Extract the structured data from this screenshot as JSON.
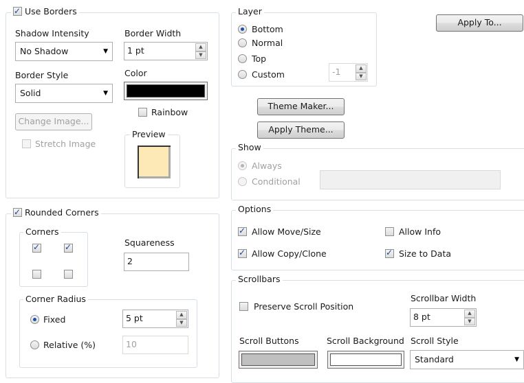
{
  "borders": {
    "use_borders_label": "Use Borders",
    "use_borders_checked": true,
    "shadow_intensity_label": "Shadow Intensity",
    "shadow_intensity_value": "No Shadow",
    "border_width_label": "Border Width",
    "border_width_value": "1 pt",
    "border_style_label": "Border Style",
    "border_style_value": "Solid",
    "color_label": "Color",
    "color_value": "#000000",
    "rainbow_label": "Rainbow",
    "change_image_label": "Change Image...",
    "stretch_image_label": "Stretch Image",
    "preview_label": "Preview"
  },
  "layer": {
    "title": "Layer",
    "options": [
      "Bottom",
      "Normal",
      "Top",
      "Custom"
    ],
    "selected": "Bottom",
    "custom_value": "-1"
  },
  "buttons": {
    "apply_to": "Apply To...",
    "theme_maker": "Theme Maker...",
    "apply_theme": "Apply Theme..."
  },
  "show": {
    "title": "Show",
    "always_label": "Always",
    "conditional_label": "Conditional",
    "conditional_value": ""
  },
  "rounded": {
    "rounded_corners_label": "Rounded Corners",
    "rounded_corners_checked": true,
    "corners_title": "Corners",
    "corners_checked": [
      true,
      true,
      false,
      false
    ],
    "squareness_label": "Squareness",
    "squareness_value": "2",
    "corner_radius_title": "Corner Radius",
    "fixed_label": "Fixed",
    "fixed_value": "5 pt",
    "relative_label": "Relative (%)",
    "relative_value": "10"
  },
  "options": {
    "title": "Options",
    "allow_move_size": "Allow Move/Size",
    "allow_info": "Allow Info",
    "allow_copy_clone": "Allow Copy/Clone",
    "size_to_data": "Size to Data"
  },
  "scrollbars": {
    "title": "Scrollbars",
    "preserve_scroll_position": "Preserve Scroll Position",
    "scrollbar_width_label": "Scrollbar Width",
    "scrollbar_width_value": "8 pt",
    "scroll_buttons_label": "Scroll Buttons",
    "scroll_buttons_color": "#c0c0c0",
    "scroll_background_label": "Scroll Background",
    "scroll_background_color": "#ffffff",
    "scroll_style_label": "Scroll Style",
    "scroll_style_value": "Standard"
  }
}
